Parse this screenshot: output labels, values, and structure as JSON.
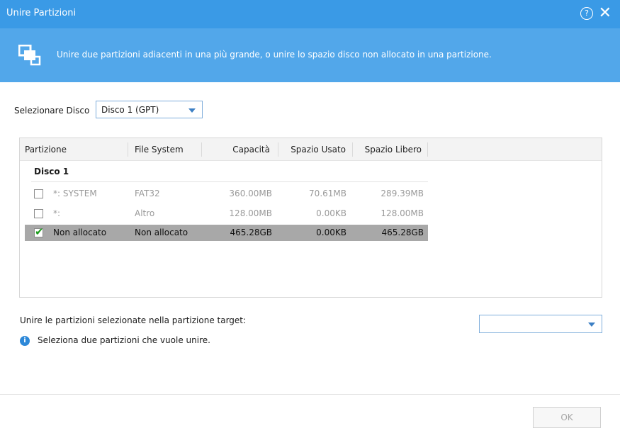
{
  "window": {
    "title": "Unire Partizioni",
    "help_glyph": "?",
    "close_glyph": "✕"
  },
  "banner": {
    "icon": "merge-partitions-icon",
    "description": "Unire due partizioni adiacenti in una più grande, o unire lo spazio disco non allocato in una partizione."
  },
  "disk_select": {
    "label": "Selezionare Disco",
    "value": "Disco 1 (GPT)"
  },
  "table": {
    "columns": {
      "partition": "Partizione",
      "filesystem": "File System",
      "capacity": "Capacità",
      "used": "Spazio Usato",
      "free": "Spazio Libero"
    },
    "group_label": "Disco 1",
    "rows": [
      {
        "name": "*: SYSTEM",
        "filesystem": "FAT32",
        "capacity": "360.00MB",
        "used": "70.61MB",
        "free": "289.39MB",
        "checked": false,
        "enabled": false
      },
      {
        "name": "*:",
        "filesystem": "Altro",
        "capacity": "128.00MB",
        "used": "0.00KB",
        "free": "128.00MB",
        "checked": false,
        "enabled": false
      },
      {
        "name": "Non allocato",
        "filesystem": "Non allocato",
        "capacity": "465.28GB",
        "used": "0.00KB",
        "free": "465.28GB",
        "checked": true,
        "enabled": true
      }
    ]
  },
  "target": {
    "label": "Unire le partizioni selezionate nella partizione target:",
    "value": ""
  },
  "info": {
    "glyph": "i",
    "text": "Seleziona due partizioni che vuole unire."
  },
  "footer": {
    "ok_label": "OK",
    "ok_enabled": false
  },
  "colors": {
    "titlebar": "#3a9ae6",
    "banner": "#52a7ea",
    "selected_row": "#a8a8a8",
    "check": "#1a9a1a"
  }
}
